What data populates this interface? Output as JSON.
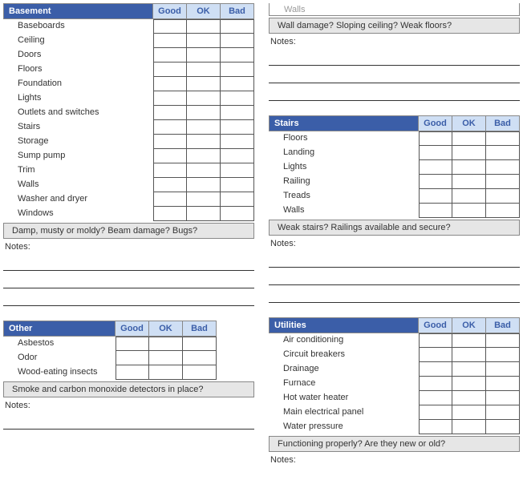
{
  "ratings": {
    "good": "Good",
    "ok": "OK",
    "bad": "Bad"
  },
  "notes_label": "Notes:",
  "left": {
    "basement": {
      "title": "Basement",
      "items": [
        "Baseboards",
        "Ceiling",
        "Doors",
        "Floors",
        "Foundation",
        "Lights",
        "Outlets and switches",
        "Stairs",
        "Storage",
        "Sump pump",
        "Trim",
        "Walls",
        "Washer and dryer",
        "Windows"
      ],
      "question": "Damp, musty or moldy? Beam damage? Bugs?"
    },
    "other": {
      "title": "Other",
      "items": [
        "Asbestos",
        "Odor",
        "Wood-eating insects"
      ],
      "question": "Smoke and carbon monoxide detectors in place?"
    }
  },
  "right": {
    "partial_top": {
      "item": "Walls",
      "question": "Wall damage? Sloping ceiling? Weak floors?"
    },
    "stairs": {
      "title": "Stairs",
      "items": [
        "Floors",
        "Landing",
        "Lights",
        "Railing",
        "Treads",
        "Walls"
      ],
      "question": "Weak stairs? Railings available and secure?"
    },
    "utilities": {
      "title": "Utilities",
      "items": [
        "Air conditioning",
        "Circuit breakers",
        "Drainage",
        "Furnace",
        "Hot water heater",
        "Main electrical panel",
        "Water pressure"
      ],
      "question": "Functioning properly? Are they new or old?"
    }
  }
}
